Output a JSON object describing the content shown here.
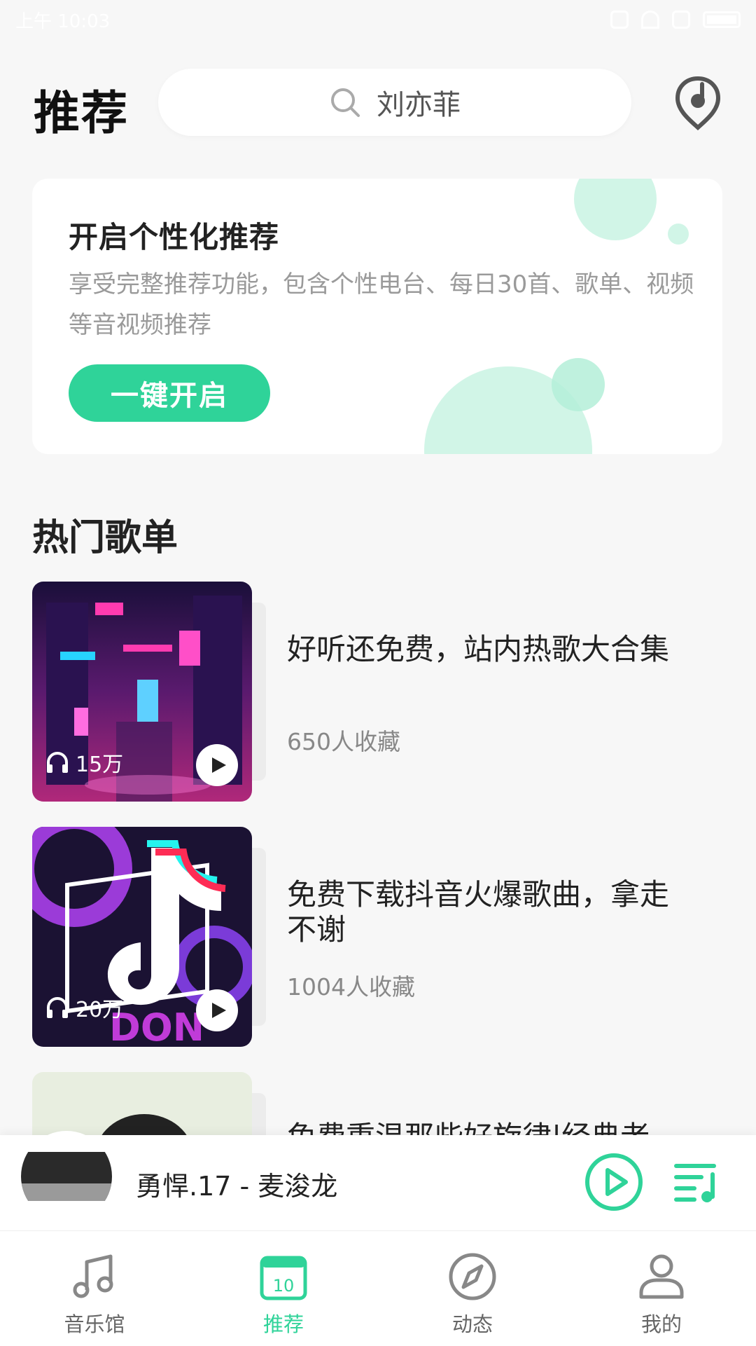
{
  "status_bar": {
    "time": "上午 10:03"
  },
  "header": {
    "title": "推荐",
    "search_text": "刘亦菲"
  },
  "promo": {
    "title": "开启个性化推荐",
    "description": "享受完整推荐功能，包含个性电台、每日30首、歌单、视频等音视频推荐",
    "button_label": "一键开启"
  },
  "section": {
    "title": "热门歌单"
  },
  "playlists": [
    {
      "title": "好听还免费，站内热歌大合集",
      "plays": "15万",
      "favorites": "650人收藏"
    },
    {
      "title": "免费下载抖音火爆歌曲，拿走不谢",
      "plays": "20万",
      "favorites": "1004人收藏"
    },
    {
      "title": "免费重温那些好旋律|经典老",
      "plays": "",
      "favorites": ""
    }
  ],
  "mini_player": {
    "now_playing": "勇悍.17 - 麦浚龙"
  },
  "tabs": [
    {
      "label": "音乐馆",
      "icon": "music-note-icon"
    },
    {
      "label": "推荐",
      "icon": "calendar-icon",
      "badge": "10"
    },
    {
      "label": "动态",
      "icon": "compass-icon"
    },
    {
      "label": "我的",
      "icon": "person-icon"
    }
  ],
  "colors": {
    "accent": "#2fd399",
    "background": "#f7f7f7"
  }
}
